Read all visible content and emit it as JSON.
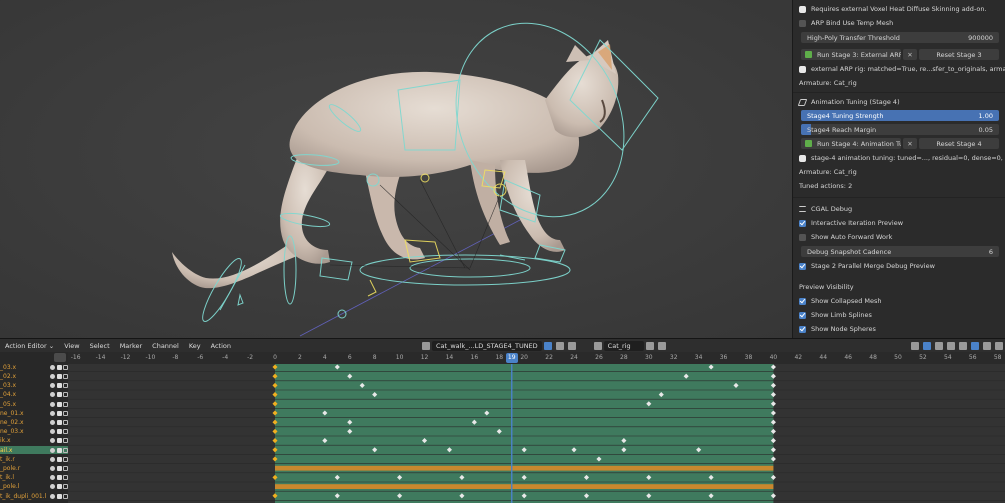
{
  "properties": {
    "addon_note": "Requires external Voxel Heat Diffuse Skinning add-on.",
    "arp_bind_temp_mesh": {
      "label": "ARP Bind Use Temp Mesh",
      "checked": false
    },
    "high_poly_threshold": {
      "label": "High-Poly Transfer Threshold",
      "value": "900000"
    },
    "stage3": {
      "run_label": "Run Stage 3: External ARP Rig",
      "reset_label": "Reset Stage 3"
    },
    "stage3_status": "external ARP rig: matched=True, re...sfer_to_originals, armature=Cat_rig",
    "armature_1": "Armature: Cat_rig",
    "animation_tuning_header": "Animation Tuning (Stage 4)",
    "tuning_strength": {
      "label": "Stage4 Tuning Strength",
      "value": "1.00"
    },
    "reach_margin": {
      "label": "Stage4 Reach Margin",
      "value": "0.05"
    },
    "stage4": {
      "run_label": "Run Stage 4: Animation Tuning",
      "reset_label": "Reset Stage 4"
    },
    "stage4_status": "stage-4 animation tuning: tuned=..., residual=0, dense=0, warnings=0",
    "armature_2": "Armature: Cat_rig",
    "tuned_actions": "Tuned actions: 2",
    "cgal_header": "CGAL Debug",
    "interactive_preview": {
      "label": "Interactive Iteration Preview",
      "checked": true
    },
    "auto_forward": {
      "label": "Show Auto Forward Work",
      "checked": false
    },
    "snapshot_cadence": {
      "label": "Debug Snapshot Cadence",
      "value": "6"
    },
    "parallel_merge": {
      "label": "Stage 2 Parallel Merge Debug Preview",
      "checked": true
    },
    "preview_visibility_header": "Preview Visibility",
    "collapsed_mesh": {
      "label": "Show Collapsed Mesh",
      "checked": true
    },
    "limb_splines": {
      "label": "Show Limb Splines",
      "checked": true
    },
    "node_spheres": {
      "label": "Show Node Spheres",
      "checked": true
    }
  },
  "timeline": {
    "editor_type": "Action Editor",
    "menus": [
      "View",
      "Select",
      "Marker",
      "Channel",
      "Key",
      "Action"
    ],
    "action_name": "Cat_walk_...LD_STAGE4_TUNED",
    "object_name": "Cat_rig",
    "current_frame": "19",
    "ruler_ticks": [
      "-16",
      "-14",
      "-12",
      "-10",
      "-8",
      "-6",
      "-4",
      "-2",
      "0",
      "2",
      "4",
      "6",
      "8",
      "10",
      "12",
      "14",
      "16",
      "18",
      "20",
      "22",
      "24",
      "26",
      "28",
      "30",
      "32",
      "34",
      "36",
      "38",
      "40",
      "42",
      "44",
      "46",
      "48",
      "50",
      "52",
      "54",
      "56",
      "58"
    ],
    "channels": [
      "_03.x",
      "_02.x",
      "_03.x",
      "_04.x",
      "_05.x",
      "ne_01.x",
      "ne_02.x",
      "ne_03.x",
      "ik.x",
      "ail.x",
      "t_ik.r",
      "_pole.r",
      "t_ik.l",
      "_pole.l",
      "t_ik_dupli_001.l"
    ],
    "selected_channel_index": 9
  },
  "colors": {
    "accent": "#4772b3",
    "keyframe": "#e8e8e8",
    "keyframe_selected": "#f0b020",
    "dopesheet": "#3f7a5e",
    "hold_bar": "#c9882e",
    "rig_shape": "#7fd8d0"
  }
}
